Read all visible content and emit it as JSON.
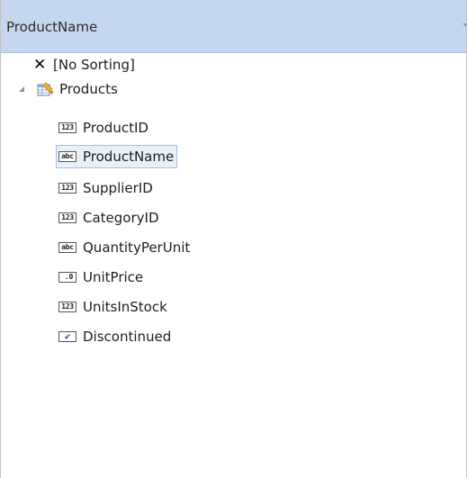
{
  "header": {
    "title": "ProductName"
  },
  "tree": {
    "no_sorting_label": "[No Sorting]",
    "table": {
      "label": "Products",
      "expanded": true
    },
    "fields": [
      {
        "label": "ProductID",
        "type_icon": "123",
        "icon_name": "integer-icon"
      },
      {
        "label": "ProductName",
        "type_icon": "abc",
        "icon_name": "string-icon",
        "selected": true
      },
      {
        "label": "SupplierID",
        "type_icon": "123",
        "icon_name": "integer-icon"
      },
      {
        "label": "CategoryID",
        "type_icon": "123",
        "icon_name": "integer-icon"
      },
      {
        "label": "QuantityPerUnit",
        "type_icon": "abc",
        "icon_name": "string-icon"
      },
      {
        "label": "UnitPrice",
        "type_icon": ".0",
        "icon_name": "decimal-icon"
      },
      {
        "label": "UnitsInStock",
        "type_icon": "123",
        "icon_name": "integer-icon"
      },
      {
        "label": "Discontinued",
        "type_icon": "✔",
        "icon_name": "boolean-icon"
      }
    ]
  },
  "colors": {
    "header_bg": "#c4d7ef",
    "selection_bg": "#e8f0f8",
    "selection_border": "#a9c1e0"
  }
}
